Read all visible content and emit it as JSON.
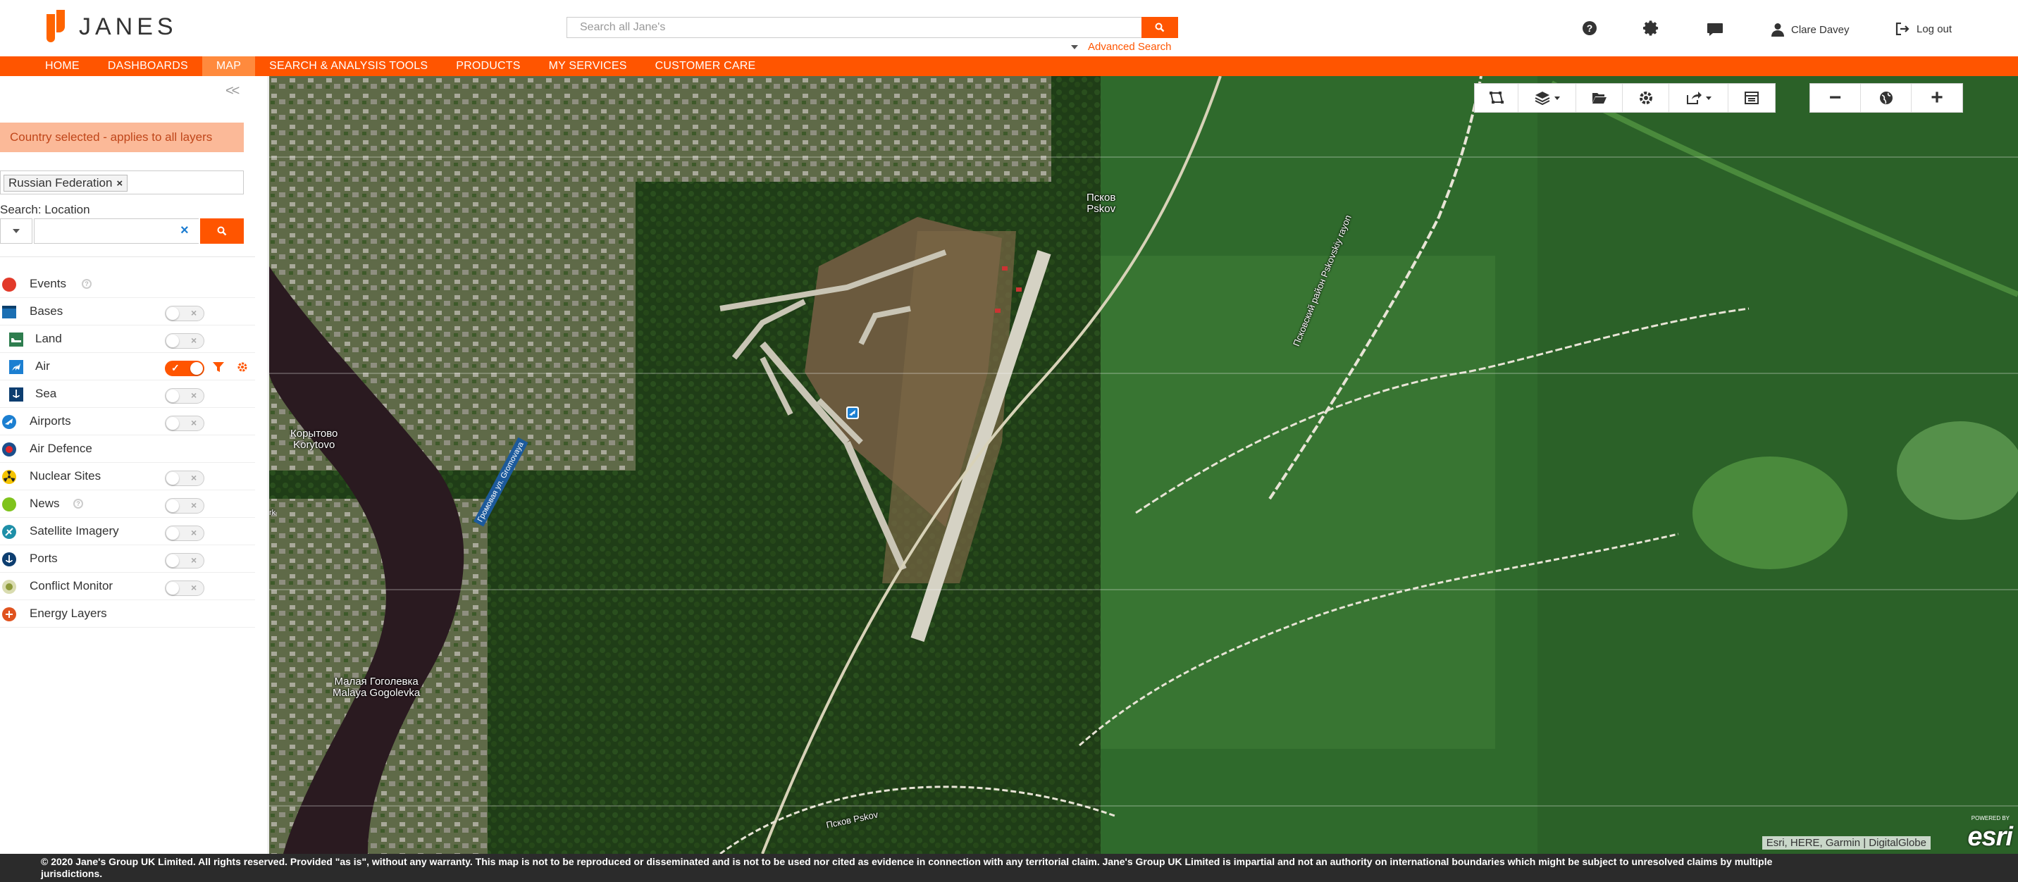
{
  "header": {
    "logo_text": "JANES",
    "search_placeholder": "Search all Jane's",
    "advanced_search": "Advanced Search",
    "user_name": "Clare Davey",
    "logout": "Log out"
  },
  "nav": {
    "items": [
      "HOME",
      "DASHBOARDS",
      "MAP",
      "SEARCH & ANALYSIS TOOLS",
      "PRODUCTS",
      "MY SERVICES",
      "CUSTOMER CARE"
    ],
    "active": "MAP"
  },
  "sidebar": {
    "collapse": "<<",
    "notice": "Country selected - applies to all layers",
    "country_chip": "Russian Federation",
    "chip_remove": "×",
    "search_label": "Search: Location",
    "location_value": "",
    "clear": "×",
    "layers": [
      {
        "label": "Events",
        "has_toggle": false,
        "on": false
      },
      {
        "label": "Bases",
        "has_toggle": true,
        "on": false
      },
      {
        "label": "Land",
        "has_toggle": true,
        "on": false
      },
      {
        "label": "Air",
        "has_toggle": true,
        "on": true
      },
      {
        "label": "Sea",
        "has_toggle": true,
        "on": false
      },
      {
        "label": "Airports",
        "has_toggle": true,
        "on": false
      },
      {
        "label": "Air Defence",
        "has_toggle": false,
        "on": false
      },
      {
        "label": "Nuclear Sites",
        "has_toggle": true,
        "on": false
      },
      {
        "label": "News",
        "has_toggle": true,
        "on": false
      },
      {
        "label": "Satellite Imagery",
        "has_toggle": true,
        "on": false
      },
      {
        "label": "Ports",
        "has_toggle": true,
        "on": false
      },
      {
        "label": "Conflict Monitor",
        "has_toggle": true,
        "on": false
      },
      {
        "label": "Energy Layers",
        "has_toggle": false,
        "on": false
      }
    ],
    "toggle_off_mark": "×",
    "toggle_on_mark": "✓",
    "info_mark": "?"
  },
  "map": {
    "labels": {
      "pskov_ru": "Псков",
      "pskov_en": "Pskov",
      "korytovo_ru": "Корытово",
      "korytovo_en": "Korytovo",
      "gogolevka_ru": "Малая Гоголевка",
      "gogolevka_en": "Malaya Gogolevka",
      "road_ru": "Псковский район Pskovskiy rayon",
      "road_bottom": "Псков Pskov",
      "street": "Громовая ул. Gromovaya",
      "park_fragment": "rk"
    },
    "zoom_out": "−",
    "zoom_in": "+",
    "attribution": "Esri, HERE, Garmin | DigitalGlobe",
    "esri_powered": "POWERED BY",
    "esri_logo": "esri"
  },
  "footer": {
    "line1": "© 2020 Jane's Group UK Limited. All rights reserved. Provided \"as is\", without any warranty. This map is not to be reproduced or disseminated and is not to be used nor cited as evidence in connection with any territorial claim. Jane's Group UK Limited is impartial and not an authority on international boundaries which might be subject to unresolved claims by multiple",
    "line2": "jurisdictions."
  },
  "colors": {
    "brand_orange": "#ff5500",
    "nav_active": "#ff8a3d",
    "notice_bg": "#fbb998",
    "footer_bg": "#2b2b2b"
  }
}
